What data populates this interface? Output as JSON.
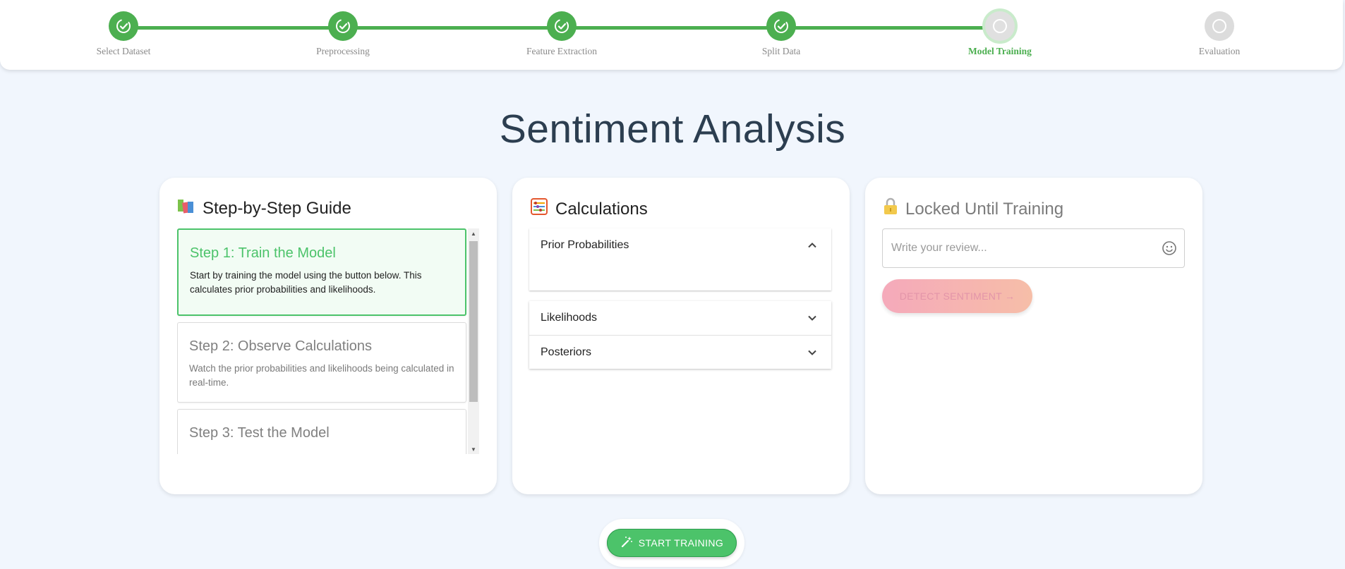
{
  "stepper": {
    "steps": [
      {
        "label": "Select Dataset",
        "status": "done"
      },
      {
        "label": "Preprocessing",
        "status": "done"
      },
      {
        "label": "Feature Extraction",
        "status": "done"
      },
      {
        "label": "Split Data",
        "status": "done"
      },
      {
        "label": "Model Training",
        "status": "active"
      },
      {
        "label": "Evaluation",
        "status": "todo"
      }
    ],
    "accent_color": "#4caf50"
  },
  "page": {
    "title": "Sentiment Analysis"
  },
  "guide": {
    "title": "Step-by-Step Guide",
    "icon": "books-icon",
    "steps": [
      {
        "title": "Step 1: Train the Model",
        "text": "Start by training the model using the button below. This calculates prior probabilities and likelihoods."
      },
      {
        "title": "Step 2: Observe Calculations",
        "text": "Watch the prior probabilities and likelihoods being calculated in real-time."
      },
      {
        "title": "Step 3: Test the Model",
        "text": ""
      }
    ]
  },
  "calculations": {
    "title": "Calculations",
    "icon": "abacus-icon",
    "sections": [
      {
        "label": "Prior Probabilities",
        "expanded": true
      },
      {
        "label": "Likelihoods",
        "expanded": false
      },
      {
        "label": "Posteriors",
        "expanded": false
      }
    ]
  },
  "locked": {
    "title": "Locked Until Training",
    "icon": "lock-icon",
    "input_placeholder": "Write your review...",
    "detect_label": "DETECT SENTIMENT →"
  },
  "train": {
    "label": "START TRAINING",
    "color": "#4cc36a"
  }
}
